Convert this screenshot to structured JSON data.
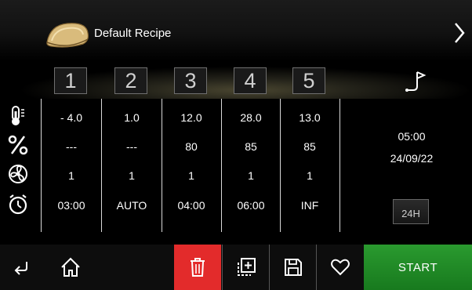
{
  "header": {
    "recipe_name": "Default Recipe"
  },
  "steps": [
    "1",
    "2",
    "3",
    "4",
    "5"
  ],
  "rows": {
    "temperature": [
      "- 4.0",
      "1.0",
      "12.0",
      "28.0",
      "13.0"
    ],
    "humidity": [
      "---",
      "---",
      "80",
      "85",
      "85"
    ],
    "fan": [
      "1",
      "1",
      "1",
      "1",
      "1"
    ],
    "time": [
      "03:00",
      "AUTO",
      "04:00",
      "06:00",
      "INF"
    ]
  },
  "side": {
    "time": "05:00",
    "date": "24/09/22",
    "mode_button": "24H"
  },
  "toolbar": {
    "start_label": "START"
  },
  "colors": {
    "delete": "#e32b2b",
    "start": "#2a9a2f",
    "background": "#000000"
  },
  "icons": [
    "recipe-bread-icon",
    "next-arrow-icon",
    "flag-icon",
    "thermometer-icon",
    "percent-icon",
    "fan-icon",
    "timer-icon",
    "back-icon",
    "home-icon",
    "trash-icon",
    "copy-add-icon",
    "save-icon",
    "heart-icon"
  ]
}
